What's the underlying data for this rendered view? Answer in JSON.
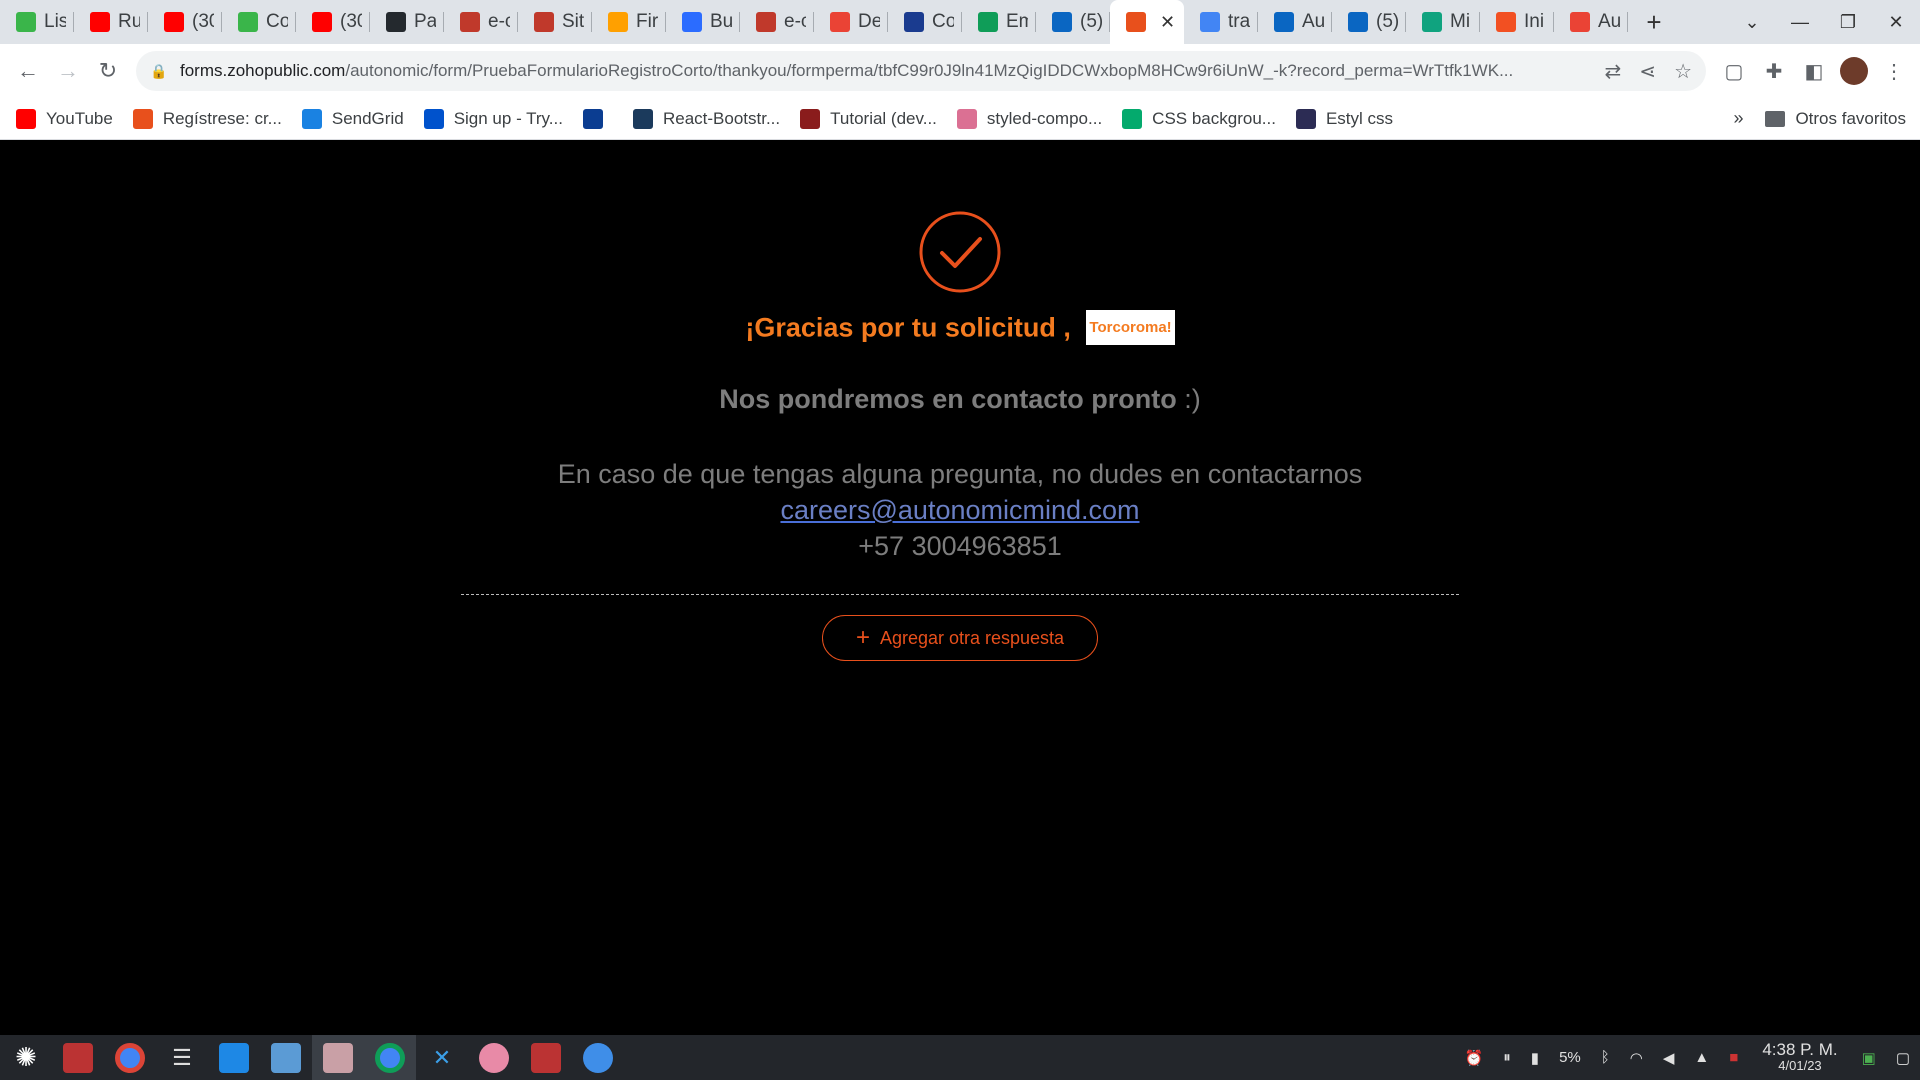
{
  "browser": {
    "tabs": [
      {
        "title": "Lis",
        "icon": "green-diamond-icon",
        "color": "#3ab54a"
      },
      {
        "title": "Ru",
        "icon": "youtube-icon",
        "color": "#ff0000"
      },
      {
        "title": "(30",
        "icon": "youtube-icon",
        "color": "#ff0000"
      },
      {
        "title": "Co",
        "icon": "green-diamond-icon",
        "color": "#3ab54a"
      },
      {
        "title": "(30",
        "icon": "youtube-icon",
        "color": "#ff0000"
      },
      {
        "title": "Pa",
        "icon": "github-icon",
        "color": "#24292e"
      },
      {
        "title": "e-c",
        "icon": "store-icon",
        "color": "#c0392b"
      },
      {
        "title": "Sit",
        "icon": "store-icon",
        "color": "#c0392b"
      },
      {
        "title": "Fir",
        "icon": "firebase-icon",
        "color": "#ffa000"
      },
      {
        "title": "Bu",
        "icon": "bootstrap-icon",
        "color": "#2b6cff"
      },
      {
        "title": "e-c",
        "icon": "store-icon",
        "color": "#c0392b"
      },
      {
        "title": "De",
        "icon": "gmail-icon",
        "color": "#ea4335"
      },
      {
        "title": "Co",
        "icon": "canvas-icon",
        "color": "#1a3b8f"
      },
      {
        "title": "Em",
        "icon": "sheets-icon",
        "color": "#0f9d58"
      },
      {
        "title": "(5)",
        "icon": "linkedin-icon",
        "color": "#0a66c2"
      },
      {
        "title": "",
        "icon": "zoho-icon",
        "color": "#e8501c",
        "active": true
      },
      {
        "title": "tra",
        "icon": "google-icon",
        "color": "#4285f4"
      },
      {
        "title": "Au",
        "icon": "linkedin-icon",
        "color": "#0a66c2"
      },
      {
        "title": "(5)",
        "icon": "linkedin-icon",
        "color": "#0a66c2"
      },
      {
        "title": "Mi",
        "icon": "chatgpt-icon",
        "color": "#10a37f"
      },
      {
        "title": "Ini",
        "icon": "microsoft-icon",
        "color": "#f25022"
      },
      {
        "title": "Au",
        "icon": "gmail-icon",
        "color": "#ea4335"
      }
    ],
    "url_host": "forms.zohopublic.com",
    "url_path": "/autonomic/form/PruebaFormularioRegistroCorto/thankyou/formperma/tbfC99r0J9ln41MzQigIDDCWxbopM8HCw9r6iUnW_-k?record_perma=WrTtfk1WK...",
    "bookmarks": [
      {
        "label": "YouTube",
        "icon": "youtube-icon",
        "color": "#ff0000"
      },
      {
        "label": "Regístrese: cr...",
        "icon": "d-icon",
        "color": "#e8501c"
      },
      {
        "label": "SendGrid",
        "icon": "sendgrid-icon",
        "color": "#1a82e2"
      },
      {
        "label": "Sign up - Try...",
        "icon": "atlassian-icon",
        "color": "#0052cc"
      },
      {
        "label": "",
        "icon": "nasa-icon",
        "color": "#0b3d91"
      },
      {
        "label": "React-Bootstr...",
        "icon": "react-bootstrap-icon",
        "color": "#1b3a5c"
      },
      {
        "label": "Tutorial (dev...",
        "icon": "dev-icon",
        "color": "#8a1c1c"
      },
      {
        "label": "styled-compo...",
        "icon": "styled-components-icon",
        "color": "#db7093"
      },
      {
        "label": "CSS backgrou...",
        "icon": "w3schools-icon",
        "color": "#04aa6d"
      },
      {
        "label": "Estyl css",
        "icon": "estyl-icon",
        "color": "#2c2c54"
      }
    ],
    "other_bookmarks": "Otros favoritos"
  },
  "page": {
    "thanks_text": "¡Gracias por tu solicitud ,",
    "name": "Torcoroma!",
    "contact_bold": "Nos pondremos en contacto pronto",
    "contact_tail": " :)",
    "question": "En caso de que tengas alguna pregunta, no dudes en contactarnos",
    "email": "careers@autonomicmind.com",
    "phone": "+57 3004963851",
    "add_button": "Agregar otra respuesta",
    "accent": "#e8501c"
  },
  "taskbar": {
    "battery": "5%",
    "time": "4:38 P. M.",
    "date": "4/01/23"
  }
}
